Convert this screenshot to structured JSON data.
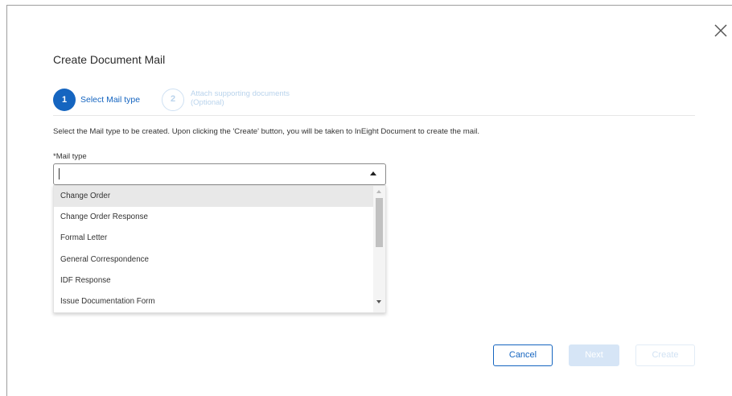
{
  "dialog": {
    "title": "Create Document Mail",
    "close_icon": "close-icon"
  },
  "steps": [
    {
      "number": "1",
      "label": "Select Mail type",
      "state": "active"
    },
    {
      "number": "2",
      "label_line1": "Attach supporting documents",
      "label_line2": "(Optional)",
      "state": "inactive"
    }
  ],
  "instruction": "Select the Mail type to be created. Upon clicking the 'Create' button, you will be taken to InEight Document to create the mail.",
  "mail_type_field": {
    "label": "*Mail type",
    "value": "",
    "placeholder": "",
    "arrow_icon": "caret-up-icon"
  },
  "dropdown": {
    "options": [
      "Change Order",
      "Change Order Response",
      "Formal Letter",
      "General Correspondence",
      "IDF Response",
      "Issue Documentation Form"
    ],
    "highlighted_index": 0
  },
  "buttons": {
    "cancel": "Cancel",
    "next": "Next",
    "create": "Create"
  },
  "colors": {
    "accent": "#1565c0",
    "disabled_fill": "#d6e5f6",
    "disabled_text": "#b9d3ec",
    "highlight_row": "#e8e8e8"
  }
}
